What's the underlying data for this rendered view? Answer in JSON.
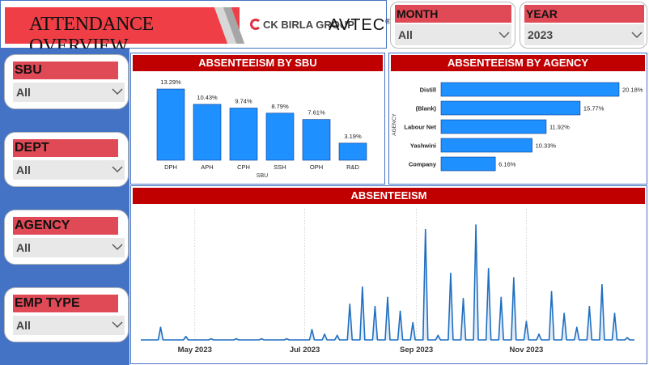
{
  "header": {
    "title": "ATTENDANCE OVERVIEW",
    "logo_ck": "CK BIRLA GROUP",
    "logo_avtec": "AVTEC",
    "logo_reg": "®"
  },
  "filters": {
    "month": {
      "label": "MONTH",
      "value": "All"
    },
    "year": {
      "label": "YEAR",
      "value": "2023"
    },
    "sbu": {
      "label": "SBU",
      "value": "All"
    },
    "dept": {
      "label": "DEPT",
      "value": "All"
    },
    "agency": {
      "label": "AGENCY",
      "value": "All"
    },
    "emp_type": {
      "label": "EMP TYPE",
      "value": "All"
    }
  },
  "colors": {
    "bar": "#1e90ff",
    "line": "#1f6fc0",
    "header_red": "#c00000",
    "slicer_red": "#e04a56",
    "sidebar_blue": "#4472c4"
  },
  "chart_data": [
    {
      "type": "bar",
      "title": "ABSENTEEISM BY SBU",
      "xlabel": "SBU",
      "categories": [
        "DPH",
        "APH",
        "CPH",
        "SSH",
        "OPH",
        "R&D"
      ],
      "values": [
        13.29,
        10.43,
        9.74,
        8.79,
        7.61,
        3.19
      ],
      "labels": [
        "13.29%",
        "10.43%",
        "9.74%",
        "8.79%",
        "7.61%",
        "3.19%"
      ]
    },
    {
      "type": "bar",
      "orientation": "horizontal",
      "title": "ABSENTEEISM BY AGENCY",
      "ylabel": "AGENCY",
      "categories": [
        "Distill",
        "(Blank)",
        "Labour Net",
        "Yashwini",
        "Company"
      ],
      "values": [
        20.18,
        15.77,
        11.92,
        10.33,
        6.16
      ],
      "labels": [
        "20.18%",
        "15.77%",
        "11.92%",
        "10.33%",
        "6.16%"
      ]
    },
    {
      "type": "line",
      "title": "ABSENTEEISM",
      "x_ticks": [
        "May 2023",
        "Jul 2023",
        "Sep 2023",
        "Nov 2023"
      ],
      "x_range": [
        "2023-04-01",
        "2023-12-31"
      ],
      "y_range": [
        0,
        100
      ],
      "grid": "vertical dotted",
      "series": [
        {
          "points": [
            [
              "2023-04-12",
              11
            ],
            [
              "2023-04-26",
              3
            ],
            [
              "2023-05-10",
              1
            ],
            [
              "2023-05-24",
              1
            ],
            [
              "2023-06-07",
              1
            ],
            [
              "2023-06-21",
              1
            ],
            [
              "2023-07-05",
              9
            ],
            [
              "2023-07-12",
              5
            ],
            [
              "2023-07-19",
              4
            ],
            [
              "2023-07-26",
              31
            ],
            [
              "2023-08-02",
              46
            ],
            [
              "2023-08-09",
              29
            ],
            [
              "2023-08-16",
              37
            ],
            [
              "2023-08-23",
              25
            ],
            [
              "2023-08-30",
              15
            ],
            [
              "2023-09-06",
              96
            ],
            [
              "2023-09-13",
              4
            ],
            [
              "2023-09-20",
              58
            ],
            [
              "2023-09-27",
              36
            ],
            [
              "2023-10-04",
              100
            ],
            [
              "2023-10-11",
              62
            ],
            [
              "2023-10-18",
              37
            ],
            [
              "2023-10-25",
              54
            ],
            [
              "2023-11-01",
              16
            ],
            [
              "2023-11-08",
              5
            ],
            [
              "2023-11-15",
              42
            ],
            [
              "2023-11-22",
              23
            ],
            [
              "2023-11-29",
              11
            ],
            [
              "2023-12-06",
              29
            ],
            [
              "2023-12-13",
              48
            ],
            [
              "2023-12-20",
              23
            ],
            [
              "2023-12-27",
              2
            ]
          ]
        }
      ]
    }
  ]
}
